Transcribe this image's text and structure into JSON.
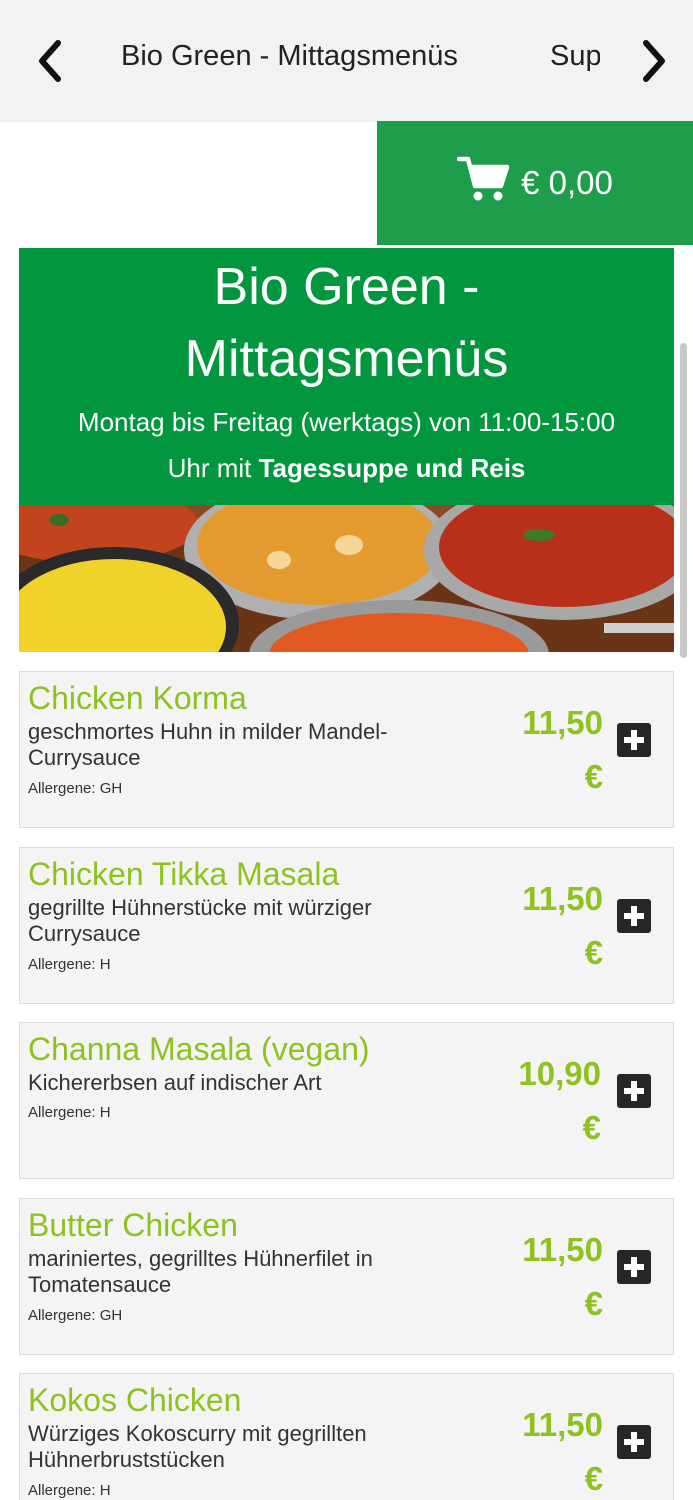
{
  "nav": {
    "active_tab": "Bio Green - Mittagsmenüs",
    "next_tab": "Suppen"
  },
  "cart": {
    "total": "€ 0,00"
  },
  "hero": {
    "title_line1": "Bio Green -",
    "title_line2": "Mittagsmenüs",
    "subtitle_line1": "Montag bis Freitag (werktags) von 11:00-15:00",
    "subtitle_line2_prefix": "Uhr mit ",
    "subtitle_line2_bold": "Tagessuppe und Reis"
  },
  "items": [
    {
      "name": "Chicken Korma",
      "desc": "geschmortes Huhn in milder Mandel-Currysauce",
      "allergens": "Allergene: GH",
      "price_value": "11,50",
      "price_currency": "€"
    },
    {
      "name": "Chicken Tikka Masala",
      "desc": "gegrillte Hühnerstücke mit würziger Currysauce",
      "allergens": "Allergene: H",
      "price_value": "11,50",
      "price_currency": "€"
    },
    {
      "name": "Channa Masala (vegan)",
      "desc": "Kichererbsen auf indischer Art",
      "allergens": "Allergene: H",
      "price_value": "10,90",
      "price_currency": "€"
    },
    {
      "name": "Butter Chicken",
      "desc": "mariniertes, gegrilltes Hühnerfilet in Tomatensauce",
      "allergens": "Allergene: GH",
      "price_value": "11,50",
      "price_currency": "€"
    },
    {
      "name": "Kokos Chicken",
      "desc": "Würziges Kokoscurry mit gegrillten Hühnerbruststücken",
      "allergens": "Allergene: H",
      "price_value": "11,50",
      "price_currency": "€"
    }
  ],
  "icons": {
    "back": "chevron-left-icon",
    "forward": "chevron-right-icon",
    "cart": "cart-icon",
    "add": "plus-icon"
  },
  "colors": {
    "brand_green": "#02973f",
    "cart_green": "#1e9e4a",
    "accent_lime": "#8dc21f"
  }
}
